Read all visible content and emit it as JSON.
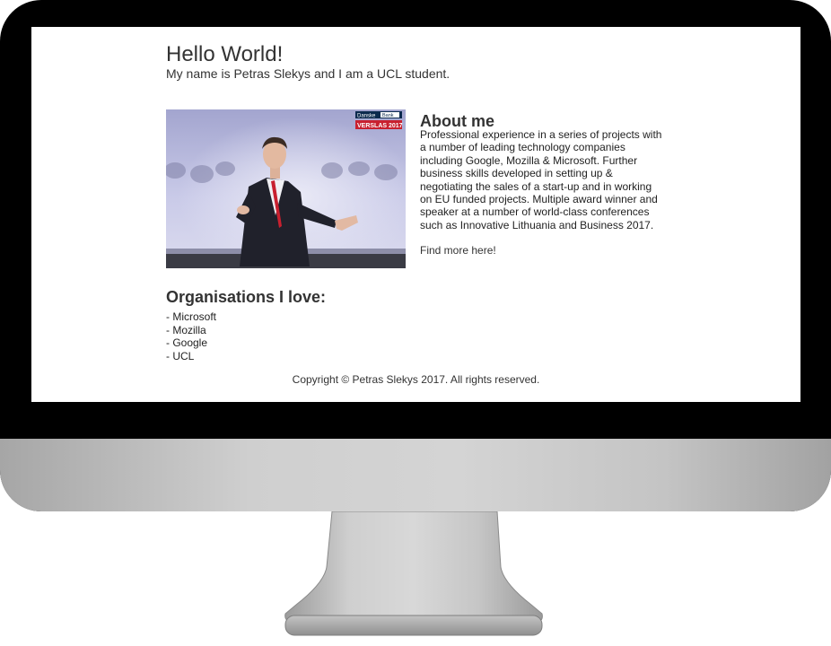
{
  "header": {
    "title": "Hello World!",
    "intro": "My name is Petras Slekys and I am a UCL student."
  },
  "photo": {
    "banner_brand_a": "Danske",
    "banner_brand_b": "Bank",
    "banner_event": "VERSLAS 2017"
  },
  "about": {
    "title": "About me",
    "text": "Professional experience in a series of projects with a number of leading technology companies including Google, Mozilla & Microsoft. Further business skills developed in setting up & negotiating the sales of a start-up and in working on EU funded projects. Multiple award winner and speaker at a number of world-class conferences such as Innovative Lithuania and Business 2017.",
    "link_label": "Find more here!"
  },
  "organisations": {
    "title": "Organisations I love:",
    "items": [
      "- Microsoft",
      "- Mozilla",
      "- Google",
      "- UCL"
    ]
  },
  "footer": {
    "copyright": "Copyright © Petras Slekys 2017. All rights reserved."
  },
  "colors": {
    "bezel": "#000000",
    "chin": "#cfcfcf",
    "text": "#333333",
    "event_badge": "#c8202f"
  }
}
